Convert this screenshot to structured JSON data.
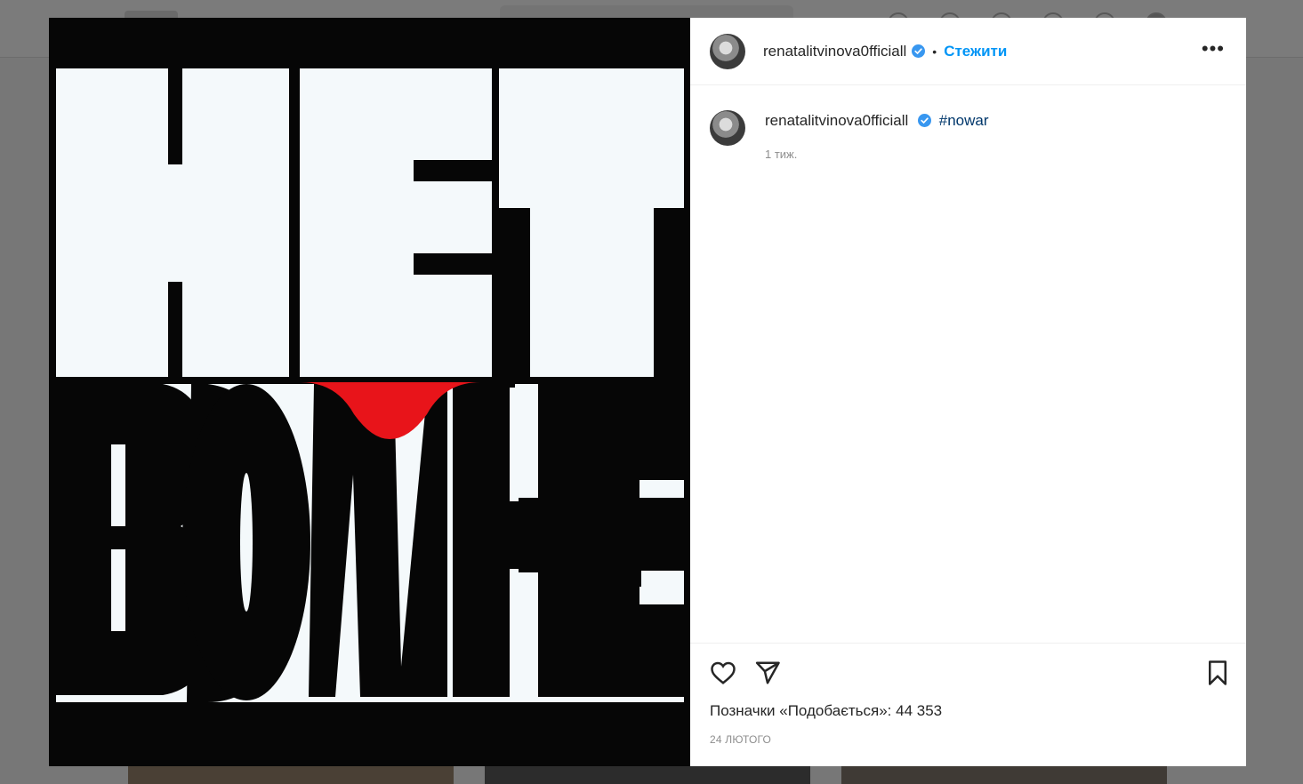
{
  "post": {
    "username": "renatalitvinova0fficiall",
    "follow_label": "Стежити",
    "more_label": "•••",
    "separator": "•",
    "caption_username": "renatalitvinova0fficiall",
    "hashtag": "#nowar",
    "caption_time": "1 тиж.",
    "likes_text": "Позначки «Подобається»: 44 353",
    "date": "24 ЛЮТОГО"
  },
  "image": {
    "text_line1": "НЕТ",
    "text_line2": "ВОЙНЕ",
    "colors": {
      "black": "#060606",
      "white": "#f4f9fb",
      "red": "#e8141a"
    }
  },
  "colors": {
    "accent": "#0095f6",
    "verified": "#3897f0",
    "hashtag": "#00376b"
  },
  "icons": [
    "heart-icon",
    "send-icon",
    "bookmark-icon",
    "verified-icon",
    "more-icon"
  ]
}
